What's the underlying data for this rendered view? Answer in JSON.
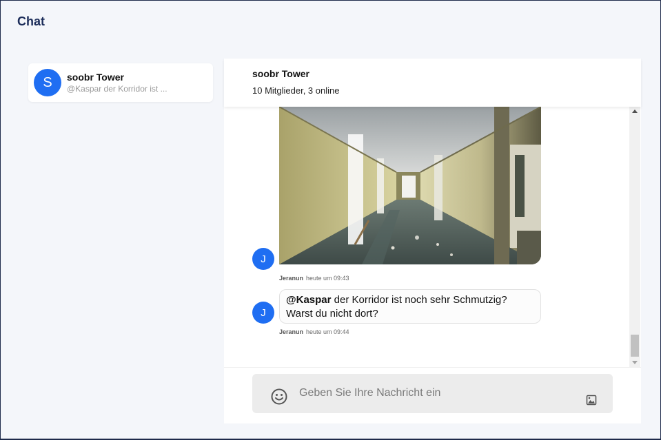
{
  "app": {
    "title": "Chat"
  },
  "conversations": [
    {
      "initial": "S",
      "name": "soobr Tower",
      "preview": "@Kaspar der Korridor ist ..."
    }
  ],
  "chat": {
    "title": "soobr Tower",
    "subtitle": "10 Mitglieder, 3 online",
    "messages": [
      {
        "type": "image",
        "avatar_initial": "J",
        "author": "Jeranun",
        "time": "heute um 09:43",
        "image_description": "hallway-photo"
      },
      {
        "type": "text",
        "avatar_initial": "J",
        "mention": "@Kaspar",
        "text": " der Korridor ist noch sehr Schmutzig? Warst du nicht dort?",
        "author": "Jeranun",
        "time": "heute um 09:44"
      }
    ]
  },
  "composer": {
    "placeholder": "Geben Sie Ihre Nachricht ein",
    "emoji_icon": "emoji-icon",
    "image_icon": "image-icon"
  },
  "colors": {
    "accent": "#1f6ef2",
    "title": "#1c2d5a",
    "background": "#f4f6fa"
  }
}
